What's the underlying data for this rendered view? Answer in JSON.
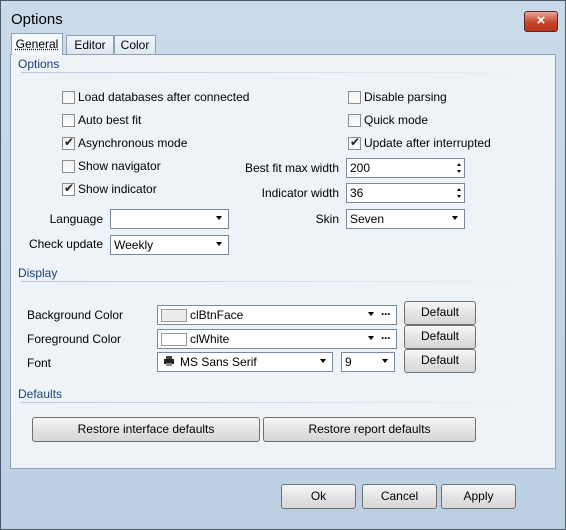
{
  "window": {
    "title": "Options",
    "close_label": "×"
  },
  "tabs": [
    "General",
    "Editor",
    "Color"
  ],
  "options": {
    "section_label": "Options",
    "checkboxes": [
      {
        "label": "Load databases after connected",
        "checked": false
      },
      {
        "label": "Auto best fit",
        "checked": false
      },
      {
        "label": "Asynchronous mode",
        "checked": true
      },
      {
        "label": "Show navigator",
        "checked": false
      },
      {
        "label": "Show indicator",
        "checked": true
      },
      {
        "label": "Disable parsing",
        "checked": false
      },
      {
        "label": "Quick mode",
        "checked": false
      },
      {
        "label": "Update after interrupted",
        "checked": true
      }
    ],
    "best_fit_max_width": {
      "label": "Best fit max width",
      "value": "200"
    },
    "indicator_width": {
      "label": "Indicator width",
      "value": "36"
    },
    "language": {
      "label": "Language",
      "value": ""
    },
    "skin": {
      "label": "Skin",
      "value": "Seven"
    },
    "check_update": {
      "label": "Check update",
      "value": "Weekly"
    }
  },
  "display": {
    "section_label": "Display",
    "background_color": {
      "label": "Background Color",
      "value": "clBtnFace",
      "swatch": "#ececec"
    },
    "foreground_color": {
      "label": "Foreground Color",
      "value": "clWhite",
      "swatch": "#ffffff"
    },
    "font": {
      "label": "Font",
      "value": "MS Sans Serif",
      "size": "9"
    },
    "default_label": "Default",
    "ellipsis": "···"
  },
  "defaults": {
    "section_label": "Defaults",
    "restore_interface": "Restore interface defaults",
    "restore_report": "Restore report defaults"
  },
  "footer": {
    "ok": "Ok",
    "cancel": "Cancel",
    "apply": "Apply"
  },
  "colors": {
    "accent_text": "#1b3f78",
    "close_red": "#c8442c"
  }
}
